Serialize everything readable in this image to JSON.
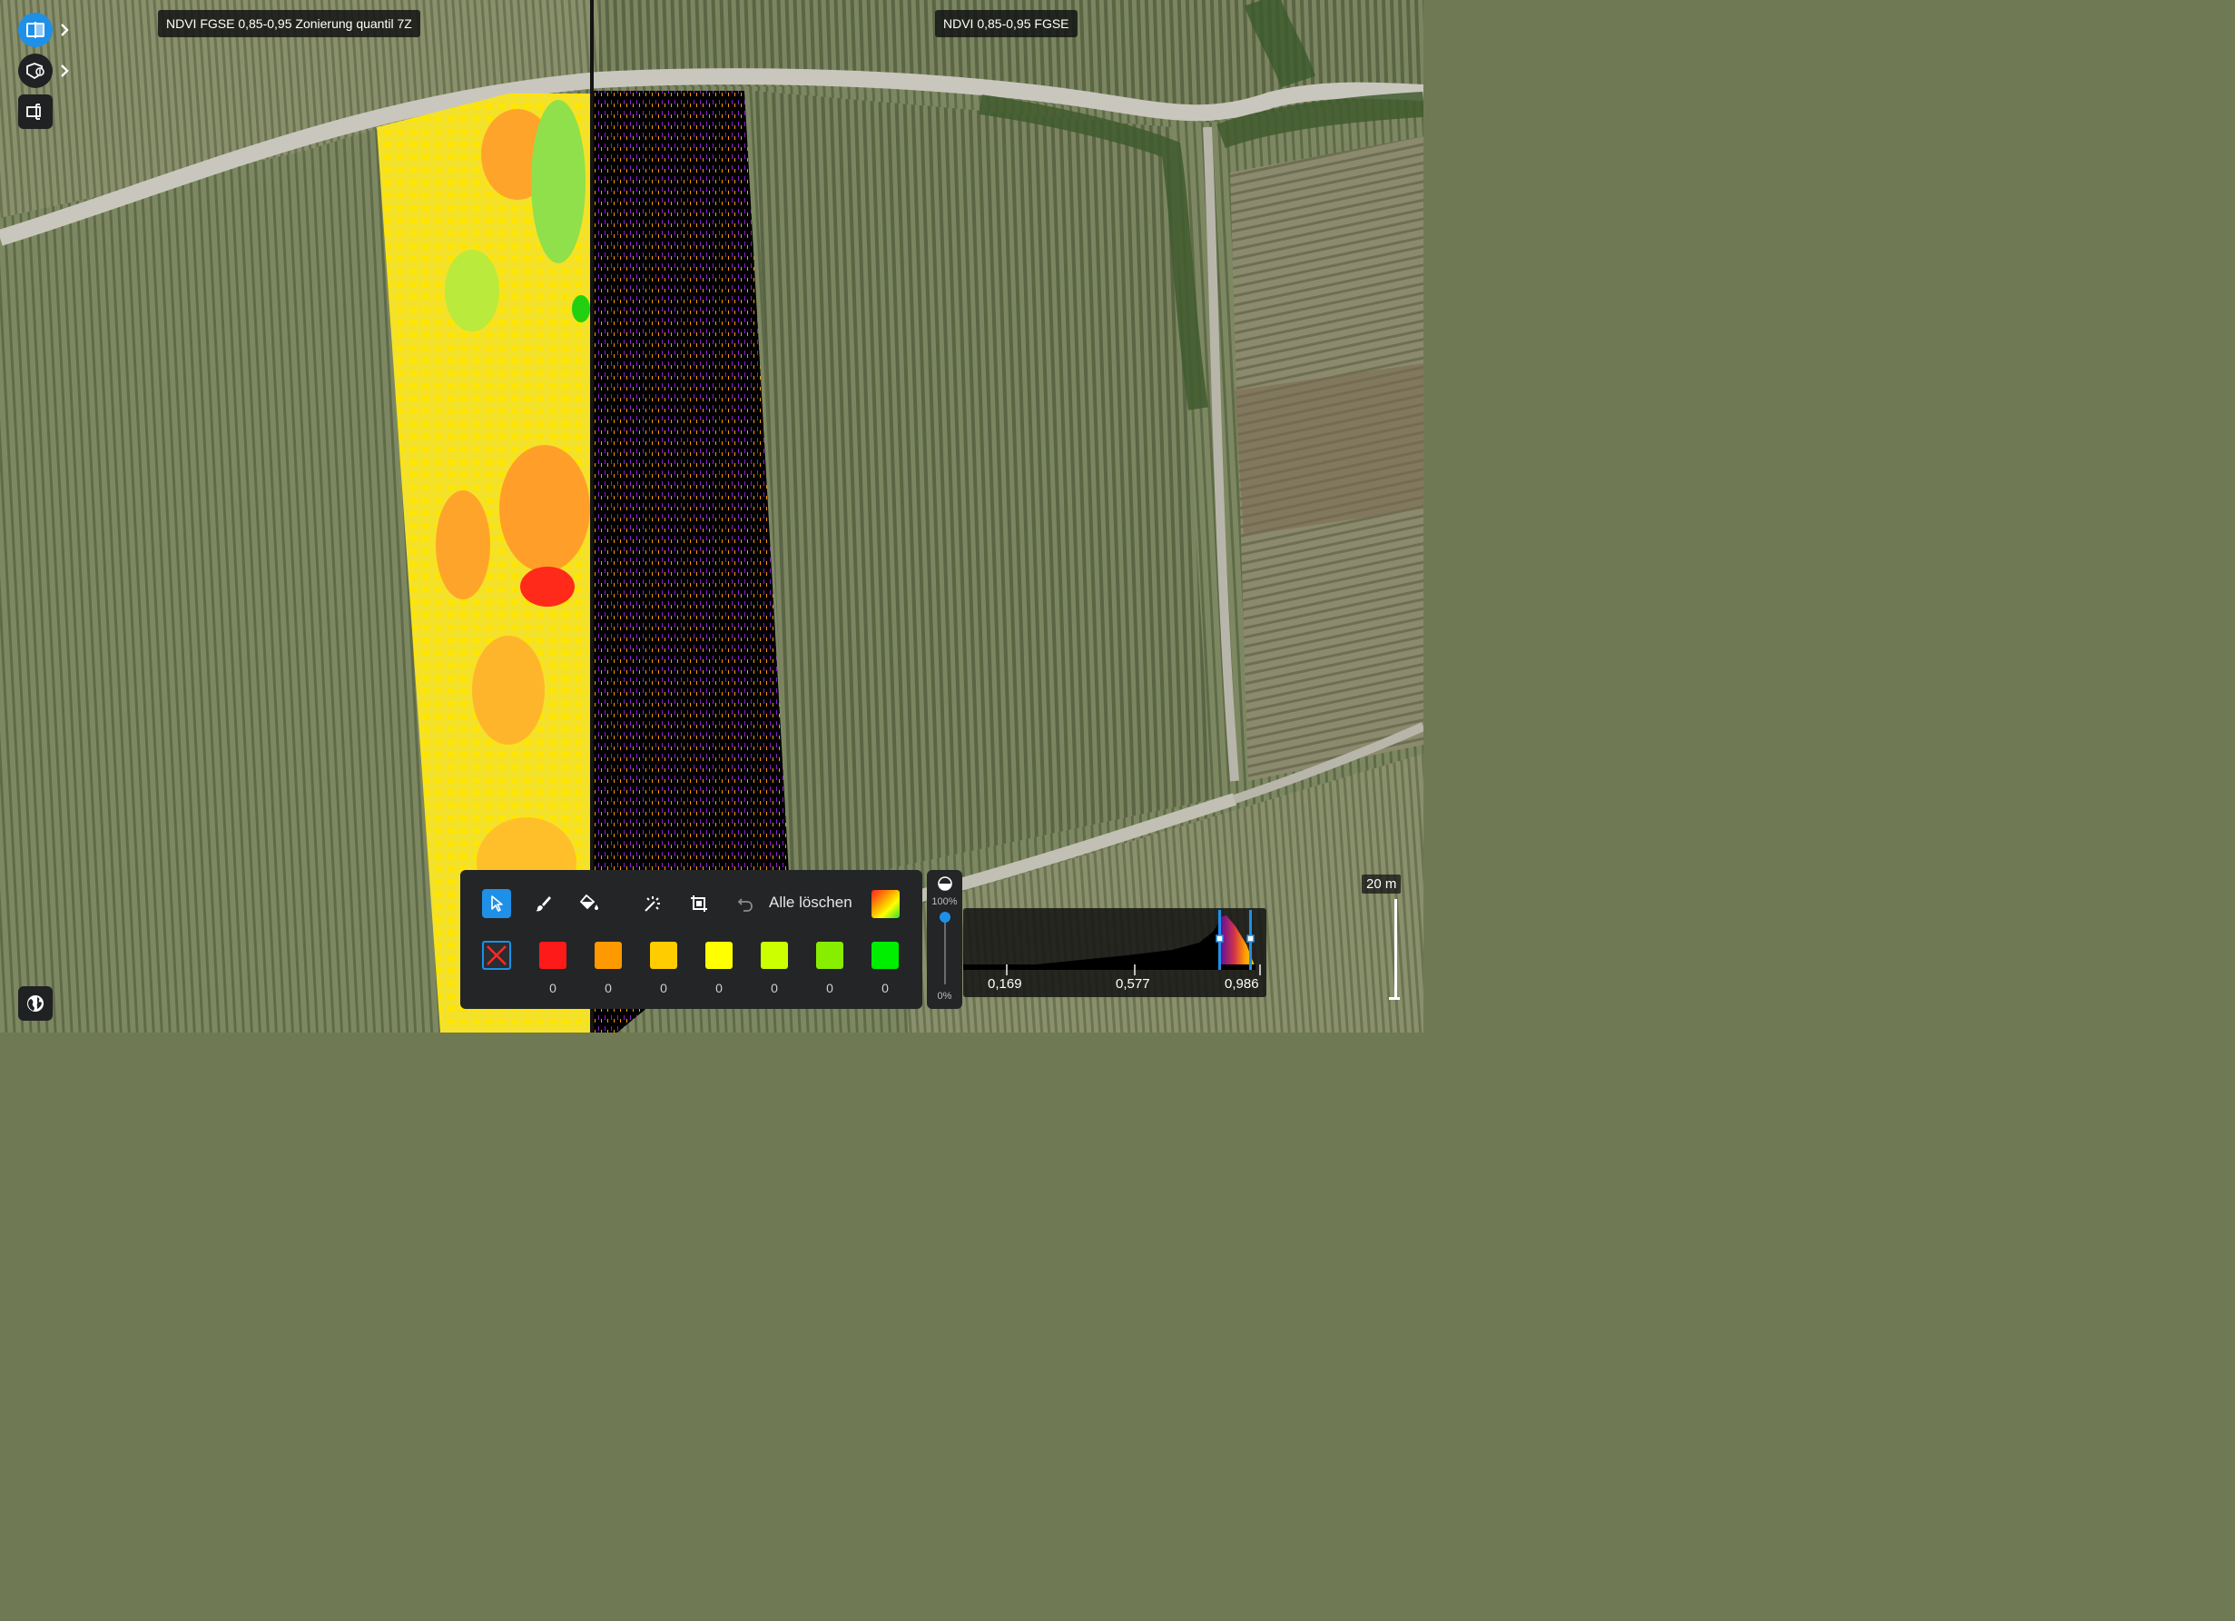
{
  "layers": {
    "left_title": "NDVI FGSE 0,85-0,95 Zonierung quantil 7Z",
    "right_title": "NDVI 0,85-0,95 FGSE"
  },
  "left_toolbar": [
    {
      "icon": "split-view-icon",
      "active": true
    },
    {
      "icon": "layer-tools-icon",
      "active": false
    },
    {
      "icon": "legend-panel-icon",
      "active": false
    }
  ],
  "zone_editor": {
    "tools": [
      "pointer-icon",
      "brush-icon",
      "fill-bucket-icon",
      "magic-select-icon",
      "crop-icon",
      "undo-icon"
    ],
    "clear_all_label": "Alle löschen",
    "zones": [
      {
        "color": "#ff1a1a",
        "count": "0"
      },
      {
        "color": "#ff9900",
        "count": "0"
      },
      {
        "color": "#ffcc00",
        "count": "0"
      },
      {
        "color": "#ffff00",
        "count": "0"
      },
      {
        "color": "#ccff00",
        "count": "0"
      },
      {
        "color": "#88ee00",
        "count": "0"
      },
      {
        "color": "#00ee00",
        "count": "0"
      }
    ]
  },
  "opacity": {
    "max_label": "100%",
    "min_label": "0%",
    "value": 1.0
  },
  "histogram": {
    "ticks": [
      "0,169",
      "0,577",
      "0,986"
    ]
  },
  "scale_bar": {
    "label": "20 m"
  },
  "colors": {
    "accent": "#1e90e8",
    "panel": "#232527"
  }
}
